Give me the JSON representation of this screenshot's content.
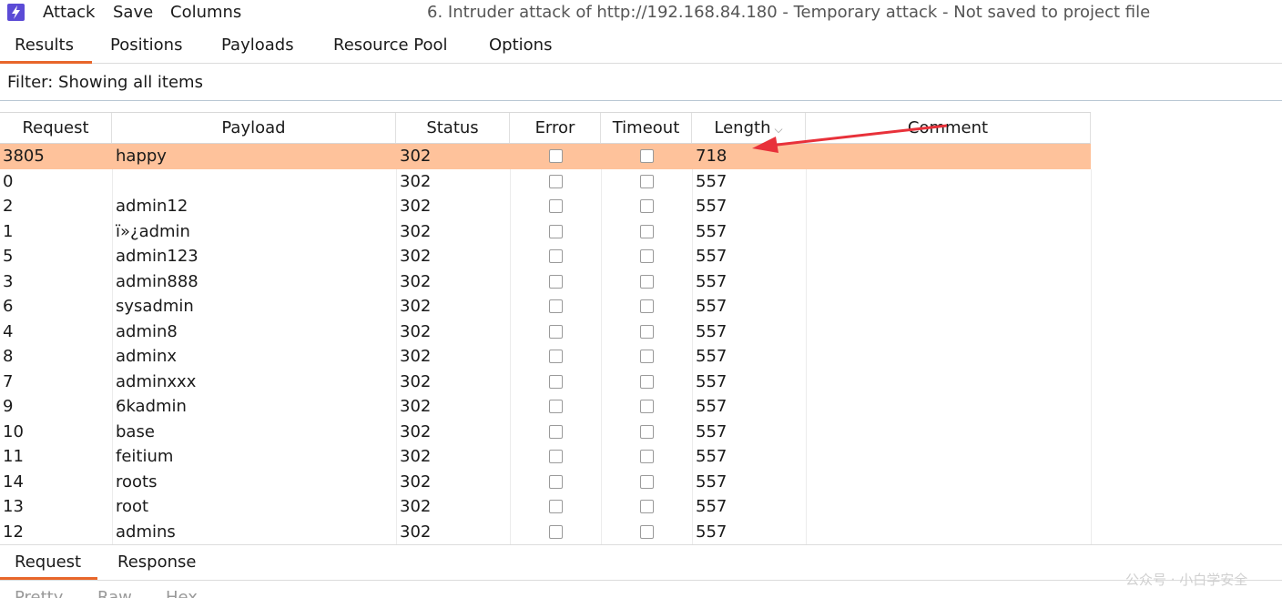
{
  "menubar": {
    "items": [
      "Attack",
      "Save",
      "Columns"
    ],
    "window_title": "6. Intruder attack of http://192.168.84.180 - Temporary attack - Not saved to project file"
  },
  "tabs": [
    "Results",
    "Positions",
    "Payloads",
    "Resource Pool",
    "Options"
  ],
  "filter": {
    "text": "Filter: Showing all items"
  },
  "table": {
    "columns": [
      "Request",
      "Payload",
      "Status",
      "Error",
      "Timeout",
      "Length",
      "Comment"
    ],
    "rows": [
      {
        "request": "3805",
        "payload": "happy",
        "status": "302",
        "length": "718",
        "selected": true
      },
      {
        "request": "0",
        "payload": "",
        "status": "302",
        "length": "557"
      },
      {
        "request": "2",
        "payload": "admin12",
        "status": "302",
        "length": "557"
      },
      {
        "request": "1",
        "payload": "ï»¿admin",
        "status": "302",
        "length": "557"
      },
      {
        "request": "5",
        "payload": "admin123",
        "status": "302",
        "length": "557"
      },
      {
        "request": "3",
        "payload": "admin888",
        "status": "302",
        "length": "557"
      },
      {
        "request": "6",
        "payload": "sysadmin",
        "status": "302",
        "length": "557"
      },
      {
        "request": "4",
        "payload": "admin8",
        "status": "302",
        "length": "557"
      },
      {
        "request": "8",
        "payload": "adminx",
        "status": "302",
        "length": "557"
      },
      {
        "request": "7",
        "payload": "adminxxx",
        "status": "302",
        "length": "557"
      },
      {
        "request": "9",
        "payload": "6kadmin",
        "status": "302",
        "length": "557"
      },
      {
        "request": "10",
        "payload": "base",
        "status": "302",
        "length": "557"
      },
      {
        "request": "11",
        "payload": "feitium",
        "status": "302",
        "length": "557"
      },
      {
        "request": "14",
        "payload": "roots",
        "status": "302",
        "length": "557"
      },
      {
        "request": "13",
        "payload": "root",
        "status": "302",
        "length": "557"
      },
      {
        "request": "12",
        "payload": "admins",
        "status": "302",
        "length": "557"
      }
    ]
  },
  "bottom_tabs": [
    "Request",
    "Response"
  ],
  "sub_tabs": [
    "Pretty",
    "Raw",
    "Hex"
  ],
  "watermark": "公众号 · 小白学安全",
  "colors": {
    "selected_row": "#fec29b",
    "active_tab_underline": "#e8662a",
    "annotation_arrow": "#e8313a",
    "app_icon": "#5b4bd6"
  }
}
